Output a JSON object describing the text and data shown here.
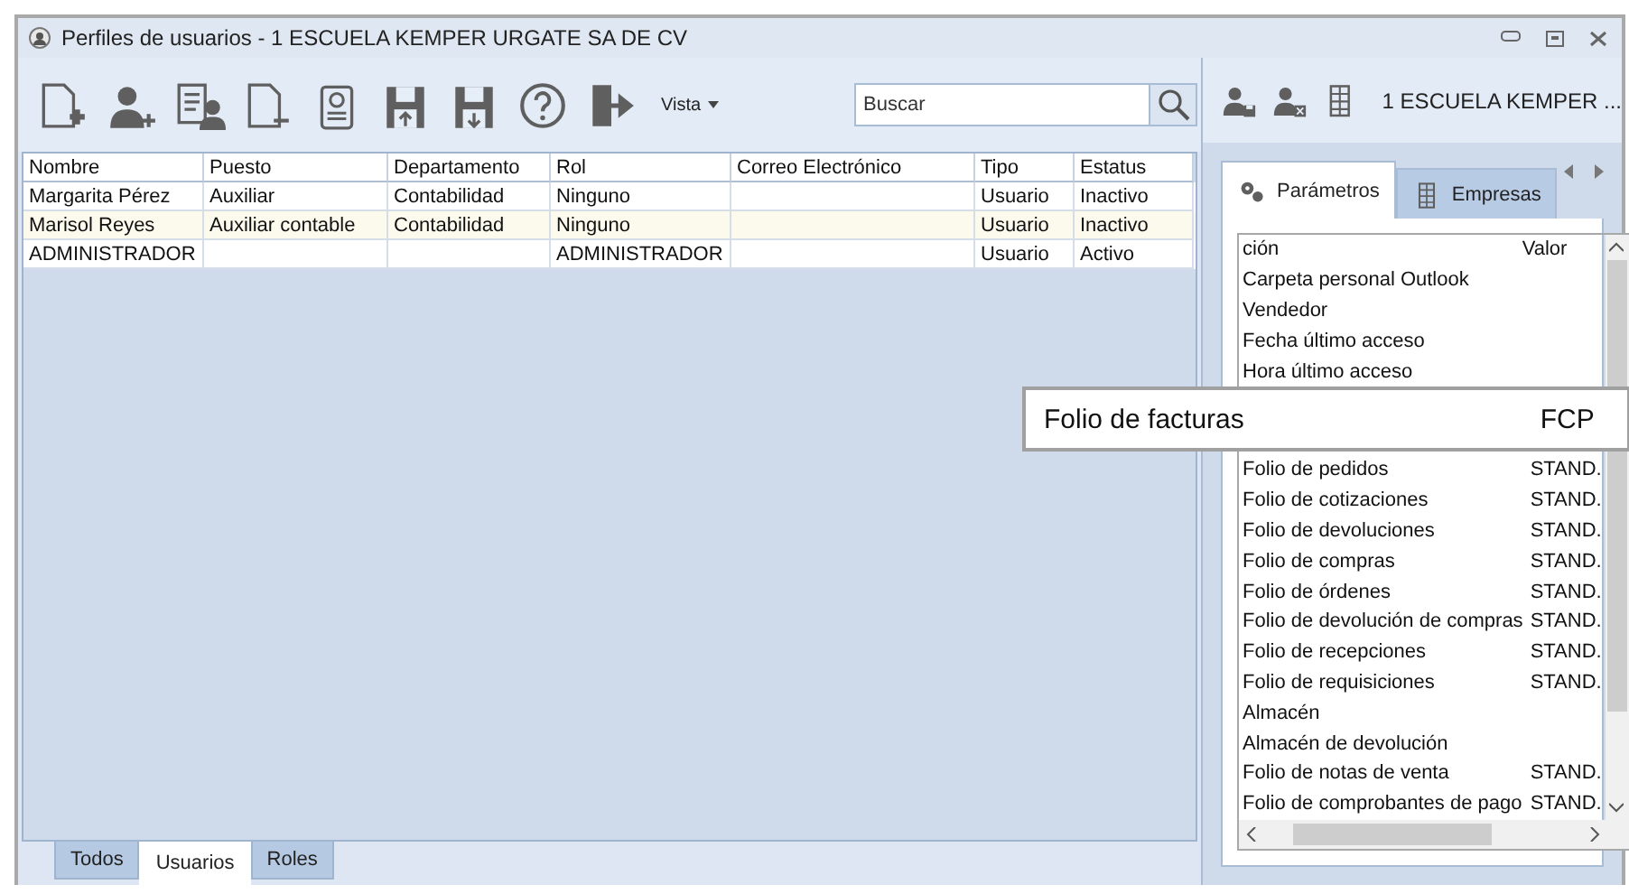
{
  "window": {
    "title": "Perfiles de usuarios - 1 ESCUELA KEMPER URGATE SA DE CV"
  },
  "toolbar": {
    "view_menu": "Vista",
    "search": {
      "placeholder": "Buscar"
    }
  },
  "users_table": {
    "columns": [
      "Nombre",
      "Puesto",
      "Departamento",
      "Rol",
      "Correo Electrónico",
      "Tipo",
      "Estatus"
    ],
    "rows": [
      {
        "cells": [
          "Margarita Pérez",
          "Auxiliar",
          "Contabilidad",
          "Ninguno",
          "",
          "Usuario",
          "Inactivo"
        ],
        "selected": false
      },
      {
        "cells": [
          "Marisol Reyes",
          "Auxiliar contable",
          "Contabilidad",
          "Ninguno",
          "",
          "Usuario",
          "Inactivo"
        ],
        "selected": true
      },
      {
        "cells": [
          "ADMINISTRADOR",
          "",
          "",
          "ADMINISTRADOR",
          "",
          "Usuario",
          "Activo"
        ],
        "selected": false
      }
    ]
  },
  "bottom_tabs": [
    {
      "label": "Todos",
      "selected": false
    },
    {
      "label": "Usuarios",
      "selected": true
    },
    {
      "label": "Roles",
      "selected": false
    }
  ],
  "right_panel": {
    "company": "1 ESCUELA KEMPER ...",
    "tabs": [
      {
        "label": "Parámetros",
        "selected": true
      },
      {
        "label": "Empresas",
        "selected": false
      }
    ],
    "columns": [
      "ción",
      "Valor"
    ],
    "rows": [
      {
        "kind": "row",
        "name": "Carpeta personal Outlook"
      },
      {
        "kind": "row",
        "name": "Vendedor"
      },
      {
        "kind": "row",
        "name": "Fecha último acceso"
      },
      {
        "kind": "row",
        "name": "Hora último acceso"
      },
      {
        "kind": "magnified",
        "name": "Folio de facturas",
        "value": "FCP"
      },
      {
        "kind": "row",
        "name": "Folio de pedidos",
        "value": "STAND."
      },
      {
        "kind": "row",
        "name": "Folio de cotizaciones",
        "value": "STAND."
      },
      {
        "kind": "row",
        "name": "Folio de devoluciones",
        "value": "STAND."
      },
      {
        "kind": "row",
        "name": "Folio de compras",
        "value": "STAND."
      },
      {
        "kind": "row",
        "name": "Folio de órdenes",
        "value": "STAND."
      },
      {
        "kind": "row",
        "name": "Folio de devolución de compras",
        "value": "STAND."
      },
      {
        "kind": "row",
        "name": "Folio de recepciones",
        "value": "STAND."
      },
      {
        "kind": "row",
        "name": "Folio de requisiciones",
        "value": "STAND."
      },
      {
        "kind": "row",
        "name": "Almacén"
      },
      {
        "kind": "row",
        "name": "Almacén de devolución"
      },
      {
        "kind": "row",
        "name": "Folio de notas de venta",
        "value": "STAND."
      },
      {
        "kind": "row",
        "name": "Folio de comprobantes de pago",
        "value": "STAND."
      }
    ]
  }
}
